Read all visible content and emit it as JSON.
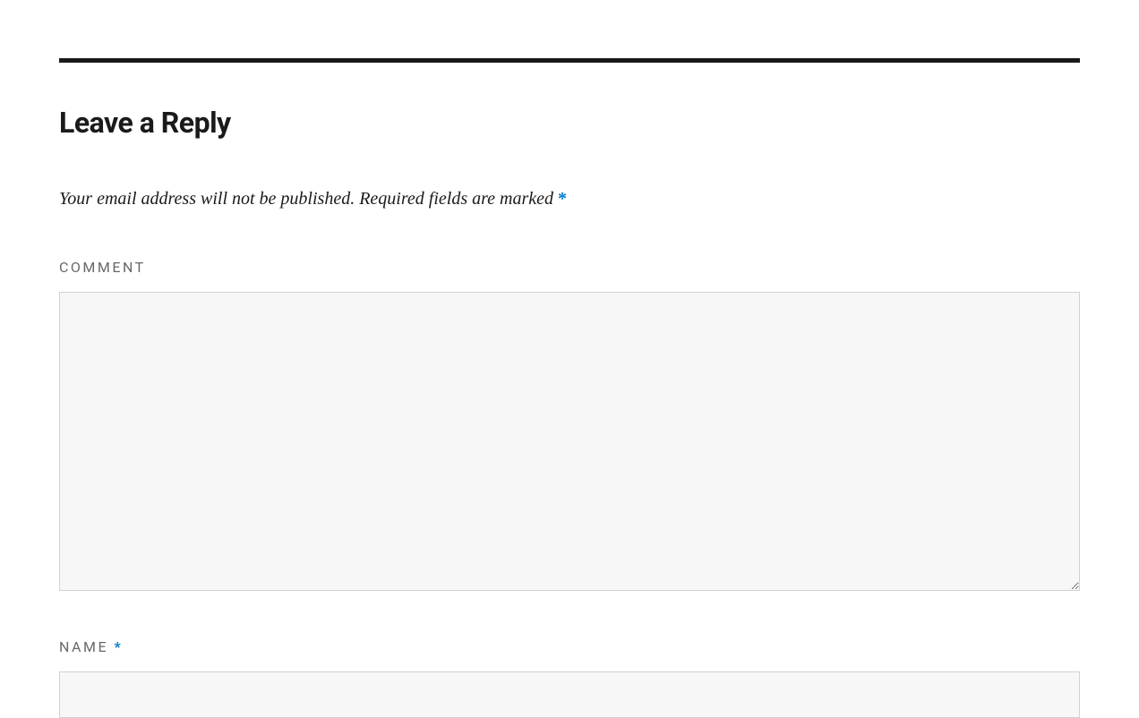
{
  "heading": "Leave a Reply",
  "notice": {
    "text_before": "Your email address will not be published. Required fields are marked ",
    "required_marker": "*"
  },
  "fields": {
    "comment": {
      "label": "COMMENT",
      "value": "",
      "required_marker": ""
    },
    "name": {
      "label": "NAME ",
      "value": "",
      "required_marker": "*"
    }
  },
  "colors": {
    "accent": "#007acc",
    "border": "#d1d1d1",
    "input_bg": "#f7f7f7",
    "divider": "#1a1a1a",
    "label": "#686868"
  }
}
